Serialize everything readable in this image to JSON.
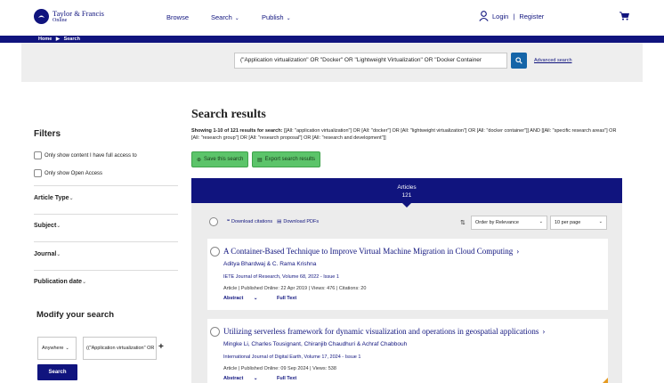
{
  "header": {
    "logo_line1": "Taylor & Francis",
    "logo_line2": "Online",
    "nav": [
      {
        "label": "Browse",
        "dropdown": false
      },
      {
        "label": "Search",
        "dropdown": true
      },
      {
        "label": "Publish",
        "dropdown": true
      }
    ],
    "login_label": "Login",
    "register_label": "Register",
    "separator": "|"
  },
  "breadcrumb": {
    "home": "Home",
    "current": "Search"
  },
  "search": {
    "query": "(\"Application virtualization\" OR \"Docker\" OR \"Lightweight Virtualization\" OR \"Docker Container",
    "advanced_label": "Advanced search"
  },
  "filters": {
    "title": "Filters",
    "checkboxes": [
      "Only show content I have full access to",
      "Only show Open Access"
    ],
    "facets": [
      "Article Type",
      "Subject",
      "Journal",
      "Publication date"
    ]
  },
  "modify": {
    "title": "Modify your search",
    "field_value": "Anywhere",
    "term_value": "((\"Application virtualization\" OR",
    "search_label": "Search"
  },
  "results": {
    "title": "Search results",
    "showing_prefix": "Showing 1-10 of 121 results for search:",
    "showing_query": "[[All: \"application virtualization\"] OR [All: \"docker\"] OR [All: \"lightweight virtualization\"] OR [All: \"docker container\"]] AND [[All: \"specific research areas\"] OR [All: \"research group\"] OR [All: \"research proposal\"] OR [All: \"research and development\"]]",
    "save_label": "Save this search",
    "export_label": "Export search results",
    "tab_label": "Articles",
    "tab_count": "121",
    "download_citations": "Download citations",
    "download_pdfs": "Download PDFs",
    "sort_value": "Order by Relevance",
    "perpage_value": "10 per page"
  },
  "articles": [
    {
      "title": "A Container-Based Technique to Improve Virtual Machine Migration in Cloud Computing",
      "authors": "Aditya Bhardwaj & C. Rama Krishna",
      "journal": "IETE Journal of Research, Volume 68, 2022 - Issue 1",
      "meta": "Article | Published Online: 22 Apr 2019 | Views: 476 | Citations: 20",
      "abstract_label": "Abstract",
      "fulltext_label": "Full Text"
    },
    {
      "title": "Utilizing serverless framework for dynamic visualization and operations in geospatial applications",
      "authors": "Mingke Li, Charles Tousignant, Chiranjib Chaudhuri & Achraf Chabbouh",
      "journal": "International Journal of Digital Earth, Volume 17, 2024 - Issue 1",
      "meta": "Article | Published Online: 09 Sep 2024 | Views: 538",
      "abstract_label": "Abstract",
      "fulltext_label": "Full Text"
    }
  ],
  "colors": {
    "brand": "#10147e",
    "green": "#5cc46a",
    "search_button": "#1565a8"
  }
}
